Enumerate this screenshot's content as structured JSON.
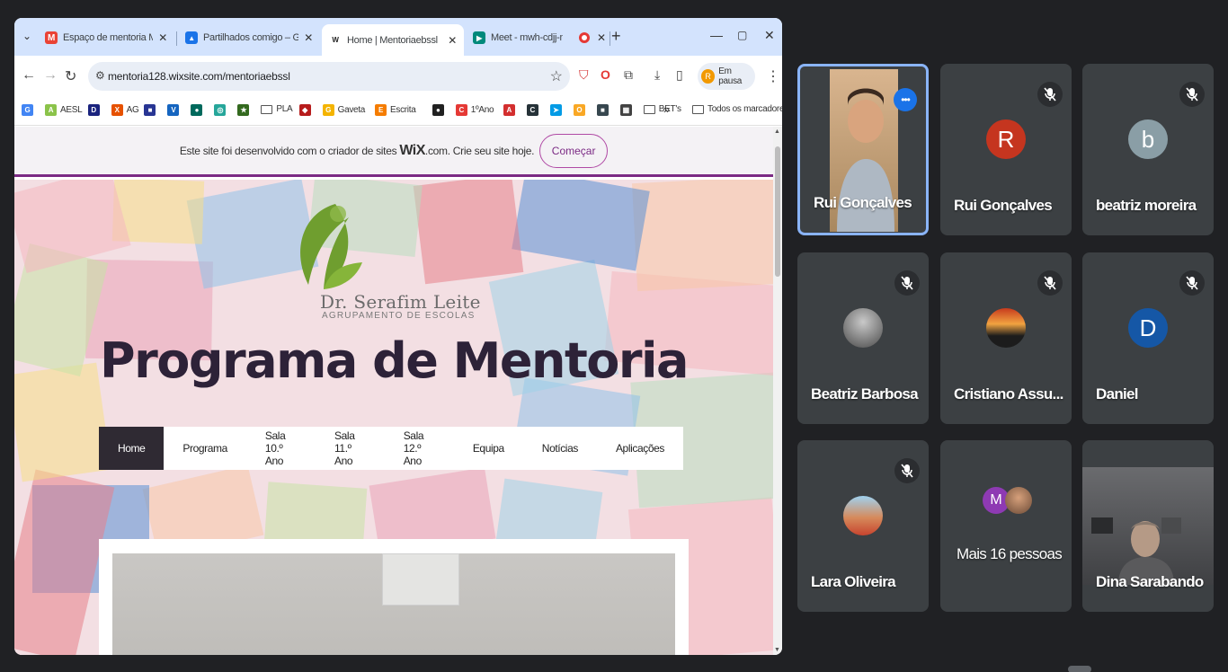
{
  "browser": {
    "tabs": [
      {
        "label": "Espaço de mentoria Mini Site -",
        "favicon": "gmail-icon",
        "color": "#ea4335",
        "glyph": "M"
      },
      {
        "label": "Partilhados comigo – Google D",
        "favicon": "drive-icon",
        "color": "#1a73e8",
        "glyph": "▲"
      },
      {
        "label": "Home | Mentoriaebssl",
        "favicon": "wix-icon",
        "color": "#222222",
        "glyph": "W"
      },
      {
        "label": "Meet - mwh-cdjj-npr",
        "favicon": "meet-icon",
        "color": "#00897b",
        "glyph": "▶"
      }
    ],
    "url": "mentoria128.wixsite.com/mentoriaebssl",
    "profile": {
      "initial": "R",
      "label": "Em pausa"
    },
    "bookmarks": [
      {
        "label": "",
        "color": "#4285f4",
        "glyph": "G"
      },
      {
        "label": "AESL",
        "color": "#8bc34a",
        "glyph": "A"
      },
      {
        "label": "",
        "color": "#1a237e",
        "glyph": "D"
      },
      {
        "label": "AG",
        "color": "#e65100",
        "glyph": "X"
      },
      {
        "label": "",
        "color": "#283593",
        "glyph": "■"
      },
      {
        "label": "",
        "color": "#1565c0",
        "glyph": "V"
      },
      {
        "label": "",
        "color": "#00695c",
        "glyph": "●"
      },
      {
        "label": "",
        "color": "#26a69a",
        "glyph": "◎"
      },
      {
        "label": "",
        "color": "#33691e",
        "glyph": "★"
      },
      {
        "label": "PLA",
        "folder": true
      },
      {
        "label": "",
        "color": "#b71c1c",
        "glyph": "◆"
      },
      {
        "label": "Gaveta",
        "color": "#f4b400",
        "glyph": "G"
      },
      {
        "label": "Escrita",
        "color": "#f57c00",
        "glyph": "E"
      },
      {
        "label": "",
        "color": "#212121",
        "glyph": "●"
      },
      {
        "label": "1ºAno",
        "color": "#e53935",
        "glyph": "C"
      },
      {
        "label": "",
        "color": "#d32f2f",
        "glyph": "A"
      },
      {
        "label": "",
        "color": "#263238",
        "glyph": "C"
      },
      {
        "label": "",
        "color": "#039be5",
        "glyph": "➤"
      },
      {
        "label": "",
        "color": "#f9a825",
        "glyph": "O"
      },
      {
        "label": "",
        "color": "#37474f",
        "glyph": "■"
      },
      {
        "label": "",
        "color": "#424242",
        "glyph": "▦"
      },
      {
        "label": "BET's",
        "folder": true
      }
    ],
    "bookmarks_more": "»",
    "all_bookmarks": "Todos os marcadores"
  },
  "wix_banner": {
    "text_before": "Este site foi desenvolvido com o criador de sites",
    "brand": "WiX",
    "text_after": ".com. Crie seu site hoje.",
    "cta": "Começar"
  },
  "site": {
    "logo_name": "Dr. Serafim Leite",
    "logo_sub": "AGRUPAMENTO DE ESCOLAS",
    "headline": "Programa de Mentoria",
    "nav": [
      "Home",
      "Programa",
      "Sala 10.º Ano",
      "Sala 11.º Ano",
      "Sala 12.º Ano",
      "Equipa",
      "Notícias",
      "Aplicações"
    ],
    "nav_active": 0
  },
  "meet": {
    "participants": [
      {
        "name": "Rui Gonçalves",
        "kind": "video",
        "speaking": true
      },
      {
        "name": "Rui Gonçalves",
        "kind": "initial",
        "initial": "R",
        "color": "#c5351f",
        "muted": true
      },
      {
        "name": "beatriz moreira",
        "kind": "initial",
        "initial": "b",
        "color": "#8a9ea6",
        "muted": true
      },
      {
        "name": "Beatriz Barbosa",
        "kind": "photo",
        "muted": true
      },
      {
        "name": "Cristiano Assu...",
        "kind": "photo",
        "muted": true
      },
      {
        "name": "Daniel",
        "kind": "initial",
        "initial": "D",
        "color": "#1557a6",
        "muted": true
      },
      {
        "name": "Lara Oliveira",
        "kind": "photo",
        "muted": true
      },
      {
        "name": "Mais 16 pessoas",
        "kind": "more",
        "initial": "M",
        "color": "#8e3ab3"
      },
      {
        "name": "Dina Sarabando",
        "kind": "video"
      }
    ]
  }
}
